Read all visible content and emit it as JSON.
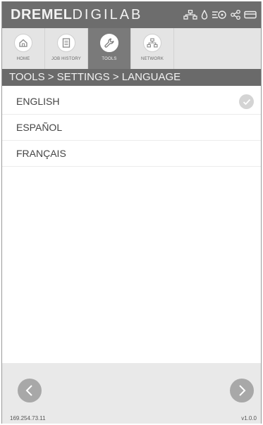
{
  "brand": {
    "bold": "DREMEL",
    "light": "DIGILAB"
  },
  "status_icons": [
    "network-icon",
    "drop-icon",
    "filament-icon",
    "share-icon",
    "card-icon"
  ],
  "tabs": [
    {
      "label": "HOME",
      "icon": "home-icon",
      "active": false
    },
    {
      "label": "JOB HISTORY",
      "icon": "document-icon",
      "active": false
    },
    {
      "label": "TOOLS",
      "icon": "wrench-icon",
      "active": true
    },
    {
      "label": "NETWORK",
      "icon": "network-icon",
      "active": false
    }
  ],
  "breadcrumb": "TOOLS > SETTINGS > LANGUAGE",
  "languages": [
    {
      "label": "ENGLISH",
      "selected": true
    },
    {
      "label": "ESPAÑOL",
      "selected": false
    },
    {
      "label": "FRANÇAIS",
      "selected": false
    }
  ],
  "footer": {
    "ip": "169.254.73.11",
    "version": "v1.0.0"
  },
  "colors": {
    "topbar": "#6d6d6d",
    "tab_active": "#7a7a7a",
    "breadcrumb": "#6a6a6a",
    "nav_button": "#a8a8a8"
  }
}
